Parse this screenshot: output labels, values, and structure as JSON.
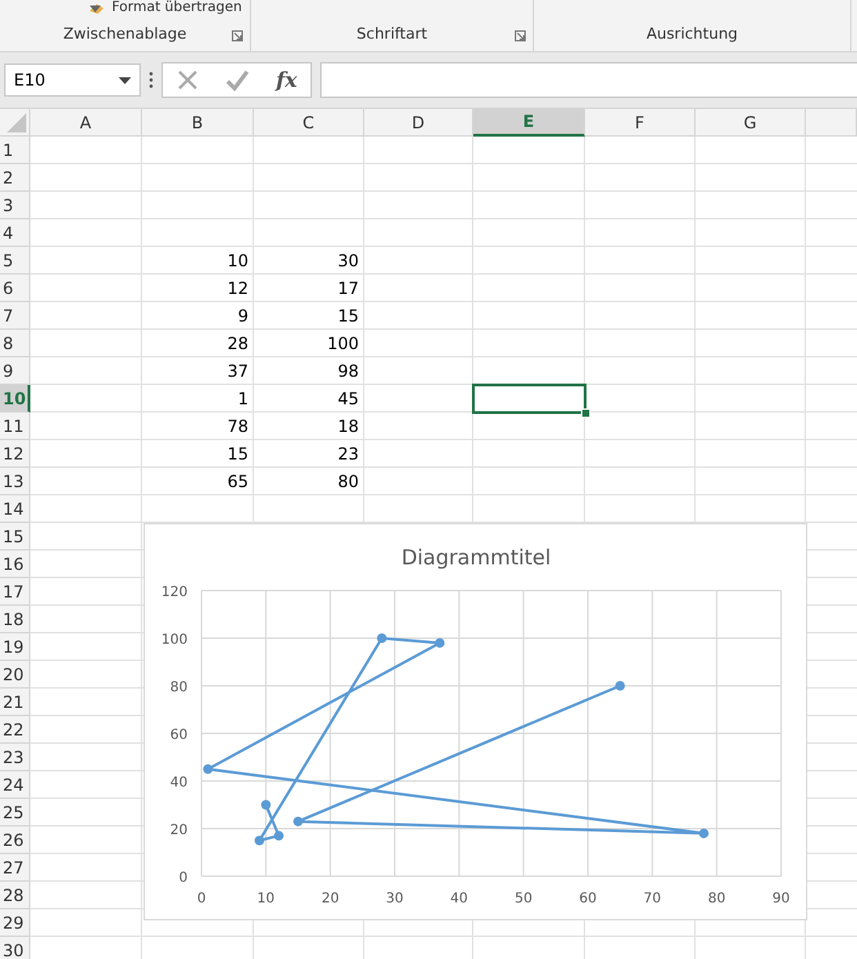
{
  "ribbon": {
    "format_painter": "Format übertragen",
    "groups": [
      {
        "label": "Zwischenablage",
        "launcher": true
      },
      {
        "label": "Schriftart",
        "launcher": true
      },
      {
        "label": "Ausrichtung",
        "launcher": false
      }
    ]
  },
  "formula_bar": {
    "name_box": "E10",
    "function_button": "fx"
  },
  "sheet": {
    "columns": [
      {
        "label": "A",
        "selected": false
      },
      {
        "label": "B",
        "selected": false
      },
      {
        "label": "C",
        "selected": false
      },
      {
        "label": "D",
        "selected": false
      },
      {
        "label": "E",
        "selected": true
      },
      {
        "label": "F",
        "selected": false
      },
      {
        "label": "G",
        "selected": false
      },
      {
        "selected": false
      }
    ],
    "rows": [
      {
        "label": "1",
        "selected": false
      },
      {
        "label": "2",
        "selected": false
      },
      {
        "label": "3",
        "selected": false
      },
      {
        "label": "4",
        "selected": false
      },
      {
        "label": "5",
        "selected": false,
        "b": "10",
        "c": "30"
      },
      {
        "label": "6",
        "selected": false,
        "b": "12",
        "c": "17"
      },
      {
        "label": "7",
        "selected": false,
        "b": "9",
        "c": "15"
      },
      {
        "label": "8",
        "selected": false,
        "b": "28",
        "c": "100"
      },
      {
        "label": "9",
        "selected": false,
        "b": "37",
        "c": "98"
      },
      {
        "label": "10",
        "selected": true,
        "b": "1",
        "c": "45"
      },
      {
        "label": "11",
        "selected": false,
        "b": "78",
        "c": "18"
      },
      {
        "label": "12",
        "selected": false,
        "b": "15",
        "c": "23"
      },
      {
        "label": "13",
        "selected": false,
        "b": "65",
        "c": "80"
      },
      {
        "label": "14",
        "selected": false
      },
      {
        "label": "15",
        "selected": false
      },
      {
        "label": "16",
        "selected": false
      },
      {
        "label": "17",
        "selected": false
      },
      {
        "label": "18",
        "selected": false
      },
      {
        "label": "19",
        "selected": false
      },
      {
        "label": "20",
        "selected": false
      },
      {
        "label": "21",
        "selected": false
      },
      {
        "label": "22",
        "selected": false
      },
      {
        "label": "23",
        "selected": false
      },
      {
        "label": "24",
        "selected": false
      },
      {
        "label": "25",
        "selected": false
      },
      {
        "label": "26",
        "selected": false
      },
      {
        "label": "27",
        "selected": false
      },
      {
        "label": "28",
        "selected": false
      },
      {
        "label": "29",
        "selected": false
      },
      {
        "label": "30",
        "selected": false
      }
    ]
  },
  "chart": {
    "chart_data": {
      "type": "line",
      "grid": true,
      "title": "Diagrammtitel",
      "x": [
        10,
        12,
        9,
        28,
        37,
        1,
        78,
        15,
        65
      ],
      "series": [
        {
          "color": "#5b9bd5",
          "marker": true,
          "values": [
            30,
            17,
            15,
            100,
            98,
            45,
            18,
            23,
            80
          ]
        }
      ],
      "xlim": [
        0,
        90
      ],
      "ylim": [
        0,
        120
      ],
      "xticks": [
        0,
        10,
        20,
        30,
        40,
        50,
        60,
        70,
        80,
        90
      ],
      "yticks": [
        0,
        20,
        40,
        60,
        80,
        100,
        120
      ]
    }
  }
}
